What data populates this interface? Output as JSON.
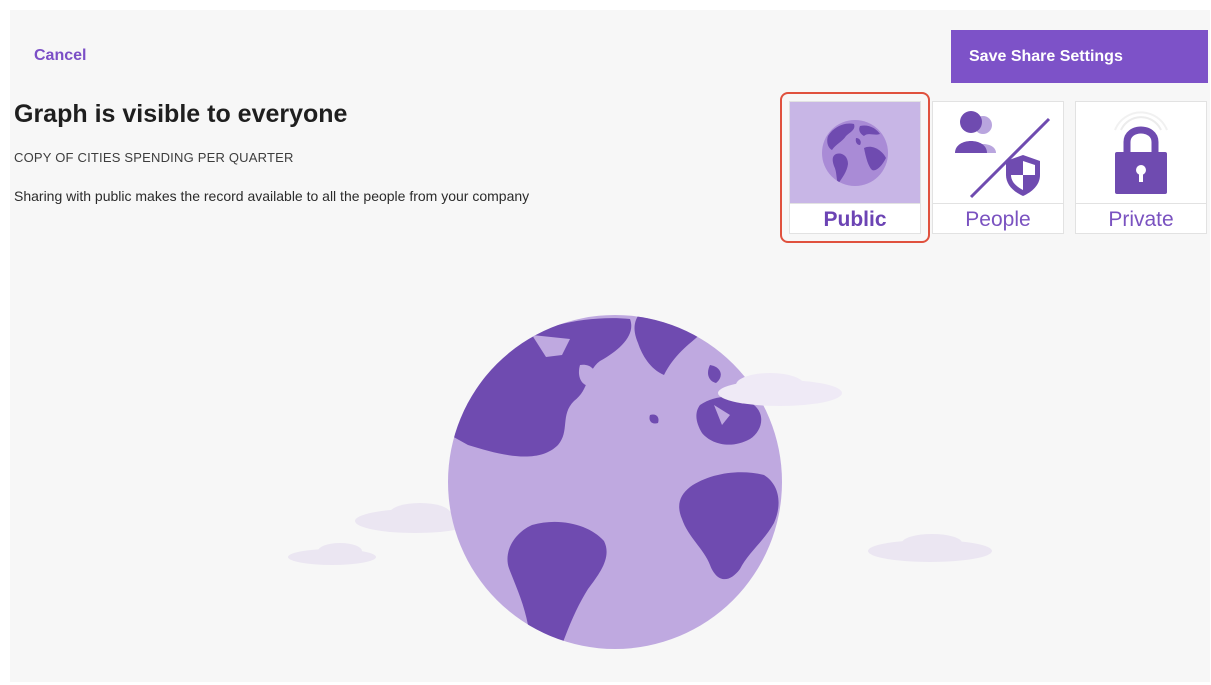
{
  "header": {
    "cancel_label": "Cancel",
    "save_label": "Save Share Settings"
  },
  "main": {
    "title": "Graph is visible to everyone",
    "subtitle": "COPY OF CITIES SPENDING PER QUARTER",
    "description": "Sharing with public makes the record available to all the people from your company"
  },
  "visibility_options": [
    {
      "label": "Public",
      "icon": "globe-icon",
      "selected": true
    },
    {
      "label": "People",
      "icon": "people-shield-icon",
      "selected": false
    },
    {
      "label": "Private",
      "icon": "padlock-icon",
      "selected": false
    }
  ],
  "colors": {
    "accent": "#7d52c8",
    "highlight": "#e0513e",
    "globe_ocean": "#bfa9e0",
    "globe_land": "#6f4bb0"
  }
}
